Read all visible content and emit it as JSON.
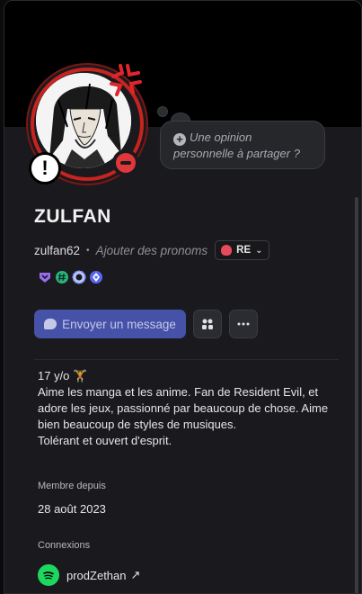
{
  "profile": {
    "display_name": "ZULFAN",
    "username": "zulfan62",
    "separator": "•",
    "pronouns_placeholder": "Ajouter des pronoms",
    "clan_tag": "RE",
    "note_placeholder": "Une opinion personnelle à partager ?",
    "status": "dnd"
  },
  "badges": [
    "nitro-badge-icon",
    "hashtag-badge-icon",
    "boost-badge-icon",
    "quest-badge-icon"
  ],
  "actions": {
    "message_label": "Envoyer un message"
  },
  "bio": {
    "text": "17 y/o 🏋\nAime les manga et les anime. Fan de Resident Evil, et adore les jeux, passionné par beaucoup de chose. Aime bien beaucoup de styles de musiques.\nTolérant et ouvert d'esprit."
  },
  "member_since": {
    "label": "Membre depuis",
    "value": "28 août 2023"
  },
  "connections": {
    "label": "Connexions",
    "items": [
      {
        "service": "spotify-icon",
        "name": "prodZethan"
      }
    ]
  },
  "colors": {
    "accent": "#4651a8",
    "avatar_ring": "#c9231f",
    "dnd": "#e0373b",
    "spotify": "#1ed760"
  }
}
